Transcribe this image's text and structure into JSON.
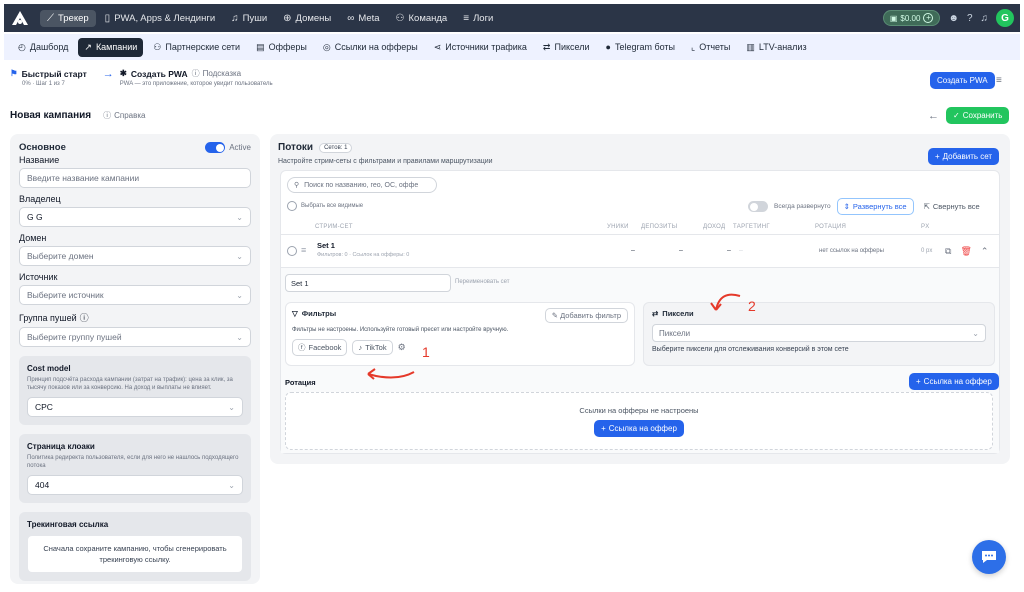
{
  "topbar": {
    "nav": [
      {
        "label": "Трекер",
        "icon": "chart-line-icon",
        "glyph": "📈"
      },
      {
        "label": "PWA, Apps & Лендинги",
        "icon": "phone-icon",
        "glyph": "▯"
      },
      {
        "label": "Пуши",
        "icon": "bell-icon",
        "glyph": "🔔"
      },
      {
        "label": "Домены",
        "icon": "globe-icon",
        "glyph": "⊕"
      },
      {
        "label": "Meta",
        "icon": "meta-icon",
        "glyph": "∞"
      },
      {
        "label": "Команда",
        "icon": "team-icon",
        "glyph": "⚇"
      },
      {
        "label": "Логи",
        "icon": "list-icon",
        "glyph": "≡"
      }
    ],
    "balance": "$0.00",
    "avatar_letter": "G"
  },
  "subnav": {
    "items": [
      {
        "label": "Дашборд",
        "glyph": "◴"
      },
      {
        "label": "Кампании",
        "glyph": "↗"
      },
      {
        "label": "Партнерские сети",
        "glyph": "⚇"
      },
      {
        "label": "Офферы",
        "glyph": "▤"
      },
      {
        "label": "Ссылки на офферы",
        "glyph": "◎"
      },
      {
        "label": "Источники трафика",
        "glyph": "⋖"
      },
      {
        "label": "Пиксели",
        "glyph": "⇄"
      },
      {
        "label": "Telegram боты",
        "glyph": "●"
      },
      {
        "label": "Отчеты",
        "glyph": "⌞"
      },
      {
        "label": "LTV-анализ",
        "glyph": "▥"
      }
    ]
  },
  "breadcrumbs": {
    "quick_start": "Быстрый старт",
    "progress": "0% · Шаг 1 из 7",
    "create_pwa": "Создать PWA",
    "hint_label": "Подсказка",
    "hint_text": "PWA — это приложение, которое увидит пользователь",
    "create_pwa_button": "Создать PWA"
  },
  "page": {
    "title": "Новая кампания",
    "help": "Справка",
    "save": "Сохранить"
  },
  "left": {
    "section_title": "Основное",
    "active_label": "Active",
    "name_label": "Название",
    "name_placeholder": "Введите название кампании",
    "owner_label": "Владелец",
    "owner_value": "G G",
    "domain_label": "Домен",
    "domain_placeholder": "Выберите домен",
    "source_label": "Источник",
    "source_placeholder": "Выберите источник",
    "push_group_label": "Группа пушей",
    "push_group_placeholder": "Выберите группу пушей",
    "cost_model_title": "Cost model",
    "cost_model_desc": "Принцип подсчёта расхода кампании (затрат на трафик): цена за клик, за тысячу показов или за конверсию. На доход и выплаты не влияет.",
    "cost_model_value": "CPC",
    "cloak_title": "Страница клоаки",
    "cloak_desc": "Политика редиректа пользователя, если для него не нашлось подходящего потока",
    "cloak_value": "404",
    "tracking_title": "Трекинговая ссылка",
    "tracking_text": "Сначала сохраните кампанию, чтобы сгенерировать трекинговую ссылку."
  },
  "streams": {
    "title": "Потоки",
    "badge": "Сетов: 1",
    "desc": "Настройте стрим-сеты с фильтрами и правилами маршрутизации",
    "add_set": "Добавить сет",
    "search_placeholder": "Поиск по названию, гео, ОС, оффе",
    "select_all": "Выбрать все видимые",
    "always_expanded": "Всегда развернуто",
    "expand_all": "Развернуть все",
    "collapse_all": "Свернуть все",
    "columns": [
      "Стрим-сет",
      "Уники",
      "Депозиты",
      "Доход",
      "Таргетинг",
      "Ротация",
      "PX"
    ],
    "row": {
      "name": "Set 1",
      "sub": "Фильтров: 0 · Ссылок на офферы: 0",
      "uniques": "–",
      "deposits": "–",
      "income": "–",
      "targeting": "–",
      "rotation": "нет ссылок на офферы",
      "px": "0 px"
    },
    "set_input_value": "Set 1",
    "rename_hint": "Переименовать сет",
    "filters_title": "Фильтры",
    "filters_desc": "Фильтры не настроены. Используйте готовый пресет или настройте вручную.",
    "add_filter": "Добавить фильтр",
    "preset_facebook": "Facebook",
    "preset_tiktok": "TikTok",
    "pixels_title": "Пиксели",
    "pixels_placeholder": "Пиксели",
    "pixels_desc": "Выберите пиксели для отслеживания конверсий в этом сете",
    "rotation_label": "Ротация",
    "offer_link_button": "Ссылка на оффер",
    "no_offers": "Ссылки на офферы не настроены",
    "offer_link_button2": "Ссылка на оффер"
  },
  "annotations": {
    "one": "1",
    "two": "2"
  },
  "colors": {
    "topbar": "#2b3547",
    "accent": "#2563eb",
    "save": "#22c55e",
    "annotation": "#e5392a"
  }
}
